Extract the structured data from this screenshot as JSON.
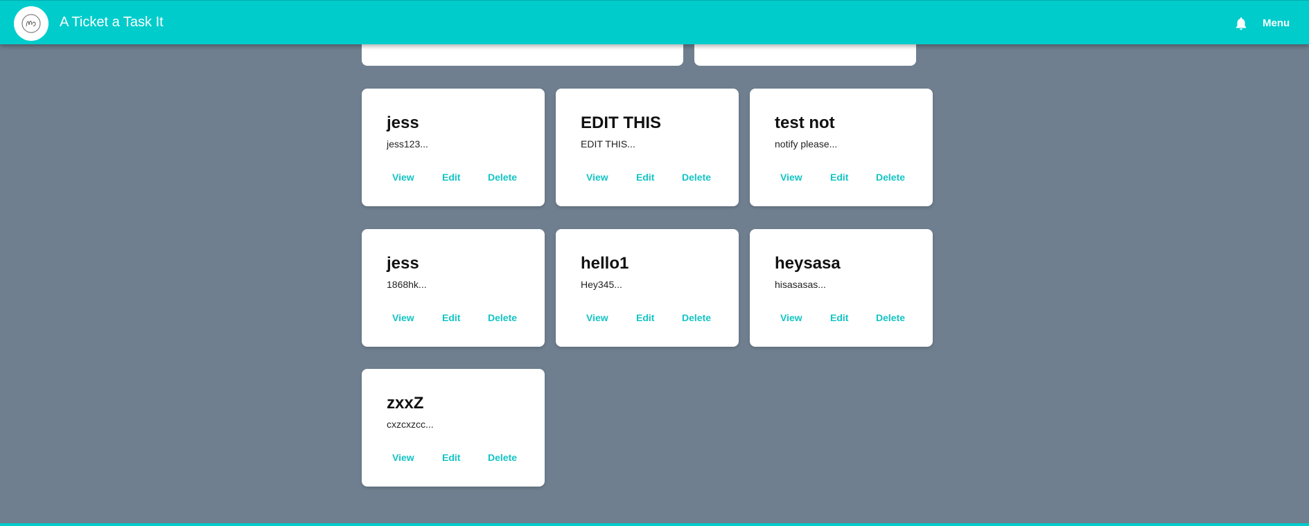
{
  "header": {
    "app_title": "A Ticket a Task It",
    "menu_label": "Menu",
    "bell_icon": "bell-icon",
    "logo_icon": "logo-icon",
    "accent_color": "#00cccc"
  },
  "cards": [
    {
      "title": "jess",
      "description": "jess123...",
      "view": "View",
      "edit": "Edit",
      "delete": "Delete"
    },
    {
      "title": "EDIT THIS",
      "description": "EDIT THIS...",
      "view": "View",
      "edit": "Edit",
      "delete": "Delete"
    },
    {
      "title": "test not",
      "description": "notify please...",
      "view": "View",
      "edit": "Edit",
      "delete": "Delete"
    },
    {
      "title": "jess",
      "description": "1868hk...",
      "view": "View",
      "edit": "Edit",
      "delete": "Delete"
    },
    {
      "title": "hello1",
      "description": "Hey345...",
      "view": "View",
      "edit": "Edit",
      "delete": "Delete"
    },
    {
      "title": "heysasa",
      "description": "hisasasas...",
      "view": "View",
      "edit": "Edit",
      "delete": "Delete"
    },
    {
      "title": "zxxZ",
      "description": "cxzcxzcc...",
      "view": "View",
      "edit": "Edit",
      "delete": "Delete"
    }
  ]
}
